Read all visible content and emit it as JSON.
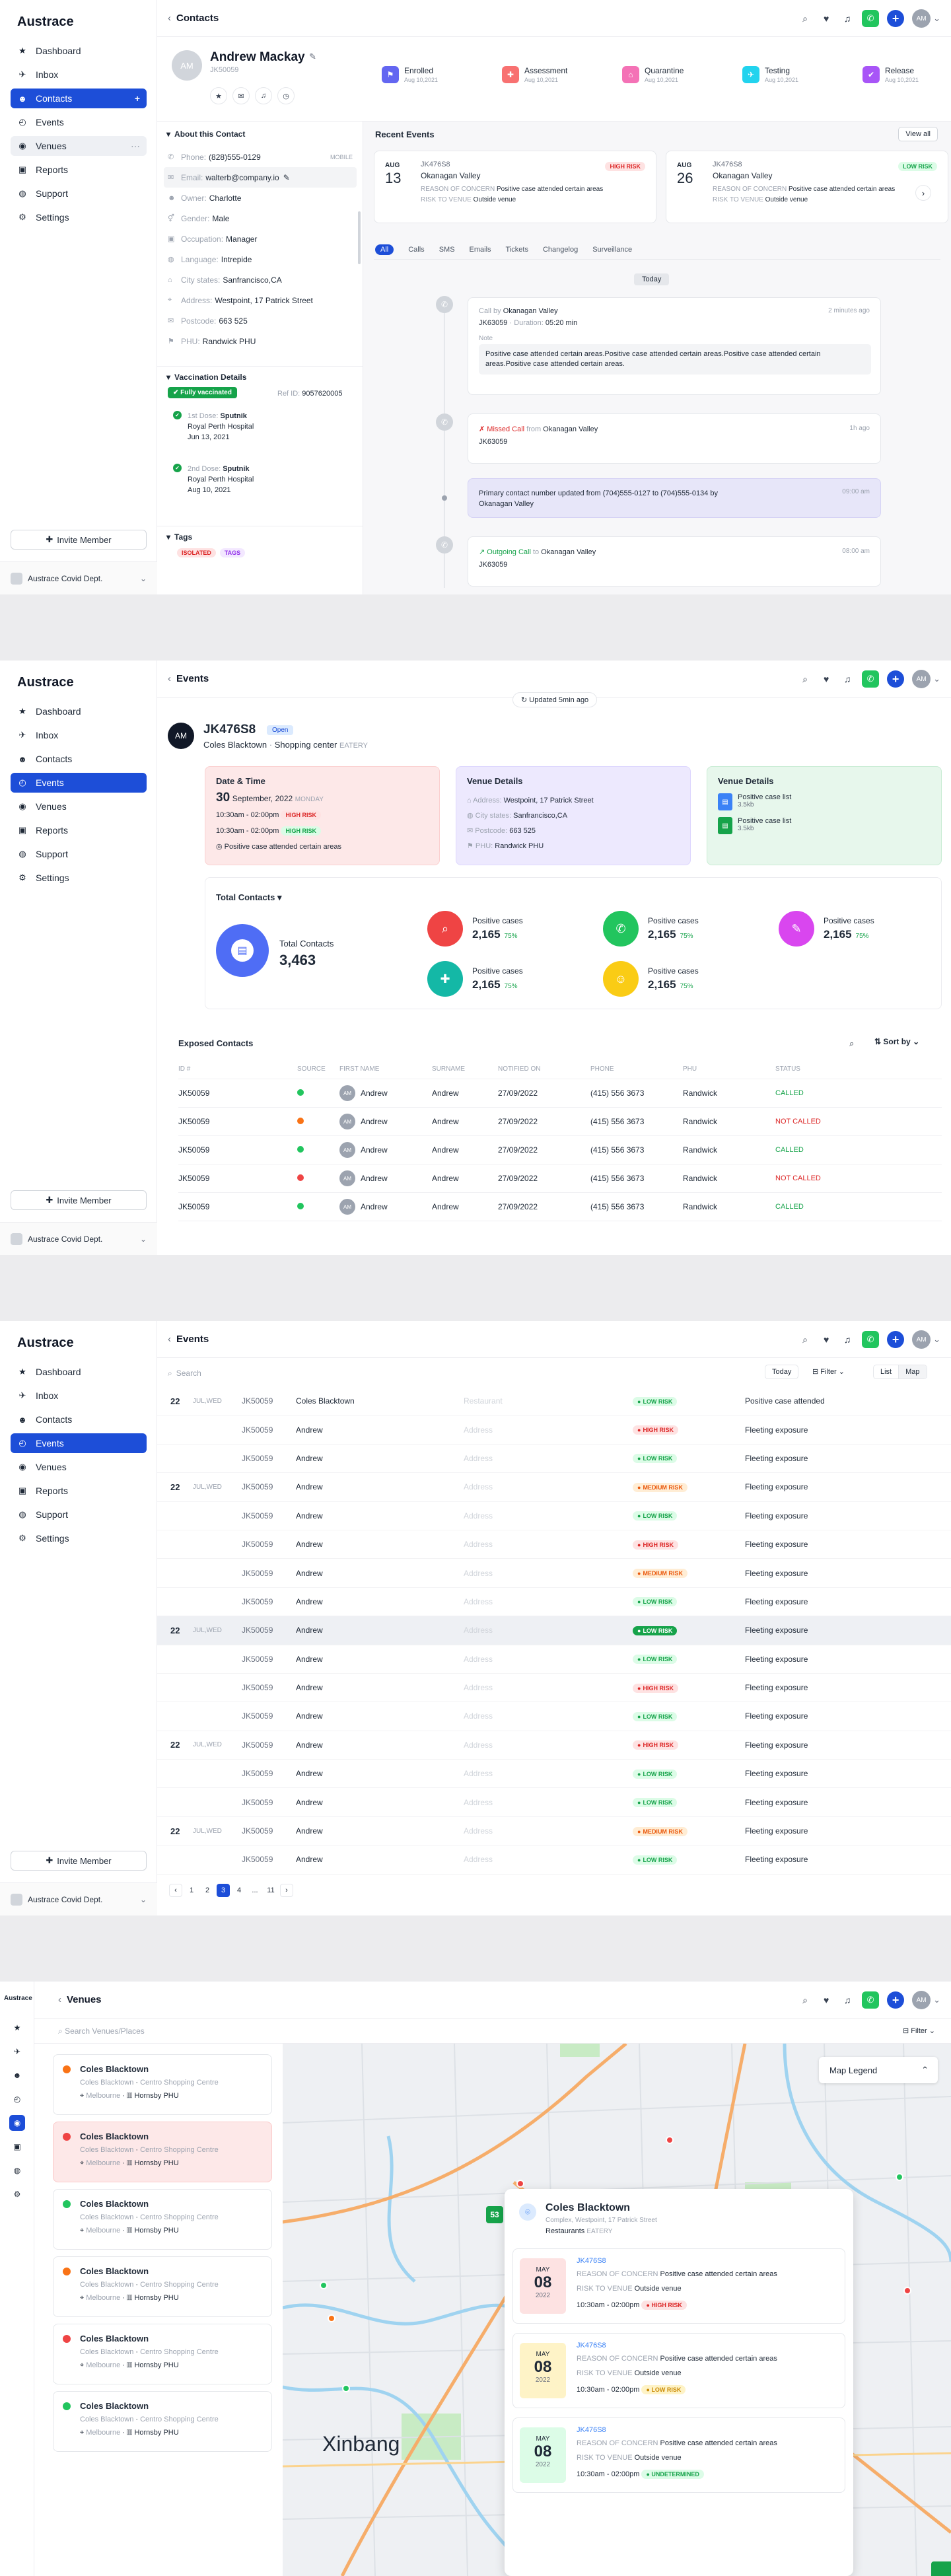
{
  "app": {
    "name": "Austrace",
    "invite": "Invite Member",
    "org": "Austrace Covid Dept.",
    "initials": "AM"
  },
  "nav": [
    {
      "label": "Dashboard",
      "icon": "★"
    },
    {
      "label": "Inbox",
      "icon": "✈"
    },
    {
      "label": "Contacts",
      "icon": "☻"
    },
    {
      "label": "Events",
      "icon": "◴"
    },
    {
      "label": "Venues",
      "icon": "◉"
    },
    {
      "label": "Reports",
      "icon": "▣"
    },
    {
      "label": "Support",
      "icon": "◍"
    },
    {
      "label": "Settings",
      "icon": "⚙"
    }
  ],
  "contacts": {
    "crumb": "Contacts",
    "name": "Andrew Mackay",
    "id": "JK50059",
    "statuses": [
      {
        "label": "Enrolled",
        "date": "Aug 10,2021",
        "color": "#6366f1",
        "icon": "⚑"
      },
      {
        "label": "Assessment",
        "date": "Aug 10,2021",
        "color": "#f87171",
        "icon": "✚"
      },
      {
        "label": "Quarantine",
        "date": "Aug 10,2021",
        "color": "#f472b6",
        "icon": "⌂"
      },
      {
        "label": "Testing",
        "date": "Aug 10,2021",
        "color": "#22d3ee",
        "icon": "✈"
      },
      {
        "label": "Release",
        "date": "Aug 10,2021",
        "color": "#a855f7",
        "icon": "✔"
      }
    ],
    "about_title": "About this Contact",
    "fields": [
      {
        "k": "Phone:",
        "v": "(828)555-0129",
        "tag": "MOBILE"
      },
      {
        "k": "Email:",
        "v": "walterb@company.io"
      },
      {
        "k": "Owner:",
        "v": "Charlotte"
      },
      {
        "k": "Gender:",
        "v": "Male"
      },
      {
        "k": "Occupation:",
        "v": "Manager"
      },
      {
        "k": "Language:",
        "v": "Intrepide"
      },
      {
        "k": "City states:",
        "v": "Sanfrancisco,CA"
      },
      {
        "k": "Address:",
        "v": "Westpoint, 17 Patrick Street"
      },
      {
        "k": "Postcode:",
        "v": "663 525"
      },
      {
        "k": "PHU:",
        "v": "Randwick PHU"
      }
    ],
    "vacc_title": "Vaccination Details",
    "vacc_badge": "Fully vaccinated",
    "ref_label": "Ref ID:",
    "ref": "9057620005",
    "doses": [
      {
        "n": "1st Dose:",
        "vax": "Sputnik",
        "place": "Royal Perth Hospital",
        "date": "Jun 13, 2021"
      },
      {
        "n": "2nd Dose:",
        "vax": "Sputnik",
        "place": "Royal Perth Hospital",
        "date": "Aug 10, 2021"
      }
    ],
    "tags_title": "Tags",
    "tags": [
      "ISOLATED",
      "TAGS"
    ],
    "recent_title": "Recent Events",
    "view_all": "View all",
    "recent": [
      {
        "mon": "AUG",
        "day": "13",
        "code": "JK476S8",
        "venue": "Okanagan Valley",
        "risk": "HIGH RISK",
        "reason_k": "REASON OF CONCERN",
        "reason": "Positive case attended certain areas",
        "rtv_k": "RISK TO VENUE",
        "rtv": "Outside venue"
      },
      {
        "mon": "AUG",
        "day": "26",
        "code": "JK476S8",
        "venue": "Okanagan Valley",
        "risk": "LOW RISK",
        "reason_k": "REASON OF CONCERN",
        "reason": "Positive case attended certain areas",
        "rtv_k": "RISK TO VENUE",
        "rtv": "Outside venue"
      }
    ],
    "filters": [
      "All",
      "Calls",
      "SMS",
      "Emails",
      "Tickets",
      "Changelog",
      "Surveillance"
    ],
    "today": "Today",
    "tl": {
      "call_by": "Call by",
      "venue": "Okanagan Valley",
      "time1": "2 minutes ago",
      "code": "JK63059",
      "dur": "Duration:",
      "dur_v": "05:20 min",
      "note_k": "Note",
      "note": "Positive case attended certain areas.Positive case attended certain areas.Positive case attended certain areas.Positive case attended certain areas.",
      "missed": "Missed Call",
      "from": "from",
      "time2": "1h ago",
      "upd": "Primary contact number updated from (704)555-0127 to (704)555-0134 by",
      "time3": "09:00 am",
      "outgoing": "Outgoing Call",
      "to": "to",
      "time4": "08:00 am"
    }
  },
  "event": {
    "crumb": "Events",
    "updated": "Updated 5min ago",
    "code": "JK476S8",
    "open": "Open",
    "venue": "Coles Blacktown",
    "type": "Shopping center",
    "type_tag": "EATERY",
    "dt_title": "Date & Time",
    "dt_day": "30",
    "dt_month": "September, 2022",
    "dt_dow": "MONDAY",
    "slots": [
      {
        "t": "10:30am - 02:00pm",
        "r": "HIGH RISK"
      },
      {
        "t": "10:30am - 02:00pm",
        "r": "HIGH RISK"
      }
    ],
    "dt_note": "Positive case attended certain areas",
    "vd_title": "Venue Details",
    "vd": [
      {
        "k": "Address:",
        "v": "Westpoint, 17 Patrick Street"
      },
      {
        "k": "City states:",
        "v": "Sanfrancisco,CA"
      },
      {
        "k": "Postcode:",
        "v": "663 525"
      },
      {
        "k": "PHU:",
        "v": "Randwick PHU"
      }
    ],
    "files_title": "Venue Details",
    "files": [
      {
        "n": "Positive case list",
        "s": "3.5kb",
        "c": "#3b82f6"
      },
      {
        "n": "Positive case list",
        "s": "3.5kb",
        "c": "#16a34a"
      }
    ],
    "tc_title": "Total Contacts",
    "tc_label": "Total Contacts",
    "tc_val": "3,463",
    "stats": [
      {
        "l": "Positive cases",
        "v": "2,165",
        "p": "75%",
        "c": "#ef4444",
        "i": "⌕"
      },
      {
        "l": "Positive cases",
        "v": "2,165",
        "p": "75%",
        "c": "#22c55e",
        "i": "✆"
      },
      {
        "l": "Positive cases",
        "v": "2,165",
        "p": "75%",
        "c": "#d946ef",
        "i": "✎"
      },
      {
        "l": "Positive cases",
        "v": "2,165",
        "p": "75%",
        "c": "#14b8a6",
        "i": "✚"
      },
      {
        "l": "Positive cases",
        "v": "2,165",
        "p": "75%",
        "c": "#facc15",
        "i": "☺"
      }
    ],
    "ex_title": "Exposed Contacts",
    "sort": "Sort by",
    "cols": [
      "ID #",
      "SOURCE",
      "FIRST NAME",
      "SURNAME",
      "NOTIFIED ON",
      "PHONE",
      "PHU",
      "STATUS"
    ],
    "rows": [
      {
        "id": "JK50059",
        "src": "#22c55e",
        "fn": "Andrew",
        "sn": "Andrew",
        "d": "27/09/2022",
        "ph": "(415) 556 3673",
        "phu": "Randwick",
        "st": "CALLED"
      },
      {
        "id": "JK50059",
        "src": "#f97316",
        "fn": "Andrew",
        "sn": "Andrew",
        "d": "27/09/2022",
        "ph": "(415) 556 3673",
        "phu": "Randwick",
        "st": "NOT CALLED"
      },
      {
        "id": "JK50059",
        "src": "#22c55e",
        "fn": "Andrew",
        "sn": "Andrew",
        "d": "27/09/2022",
        "ph": "(415) 556 3673",
        "phu": "Randwick",
        "st": "CALLED"
      },
      {
        "id": "JK50059",
        "src": "#ef4444",
        "fn": "Andrew",
        "sn": "Andrew",
        "d": "27/09/2022",
        "ph": "(415) 556 3673",
        "phu": "Randwick",
        "st": "NOT CALLED"
      },
      {
        "id": "JK50059",
        "src": "#22c55e",
        "fn": "Andrew",
        "sn": "Andrew",
        "d": "27/09/2022",
        "ph": "(415) 556 3673",
        "phu": "Randwick",
        "st": "CALLED"
      }
    ]
  },
  "elist": {
    "crumb": "Events",
    "search": "Search",
    "today": "Today",
    "filter": "Filter",
    "list": "List",
    "map": "Map",
    "rows": [
      {
        "d": "22",
        "dw": "JUL,WED",
        "id": "JK50059",
        "n": "Coles Blacktown",
        "a": "Restaurant",
        "r": "LOW RISK",
        "c": "Positive case attended"
      },
      {
        "d": "",
        "dw": "",
        "id": "JK50059",
        "n": "Andrew",
        "a": "Address",
        "r": "HIGH RISK",
        "c": "Fleeting exposure"
      },
      {
        "d": "",
        "dw": "",
        "id": "JK50059",
        "n": "Andrew",
        "a": "Address",
        "r": "LOW RISK",
        "c": "Fleeting exposure"
      },
      {
        "d": "22",
        "dw": "JUL,WED",
        "id": "JK50059",
        "n": "Andrew",
        "a": "Address",
        "r": "MEDIUM RISK",
        "c": "Fleeting exposure"
      },
      {
        "d": "",
        "dw": "",
        "id": "JK50059",
        "n": "Andrew",
        "a": "Address",
        "r": "LOW RISK",
        "c": "Fleeting exposure"
      },
      {
        "d": "",
        "dw": "",
        "id": "JK50059",
        "n": "Andrew",
        "a": "Address",
        "r": "HIGH RISK",
        "c": "Fleeting exposure"
      },
      {
        "d": "",
        "dw": "",
        "id": "JK50059",
        "n": "Andrew",
        "a": "Address",
        "r": "MEDIUM RISK",
        "c": "Fleeting exposure"
      },
      {
        "d": "",
        "dw": "",
        "id": "JK50059",
        "n": "Andrew",
        "a": "Address",
        "r": "LOW RISK",
        "c": "Fleeting exposure"
      },
      {
        "d": "22",
        "dw": "JUL,WED",
        "id": "JK50059",
        "n": "Andrew",
        "a": "Address",
        "r": "LOW RISK",
        "c": "Fleeting exposure",
        "hl": true
      },
      {
        "d": "",
        "dw": "",
        "id": "JK50059",
        "n": "Andrew",
        "a": "Address",
        "r": "LOW RISK",
        "c": "Fleeting exposure"
      },
      {
        "d": "",
        "dw": "",
        "id": "JK50059",
        "n": "Andrew",
        "a": "Address",
        "r": "HIGH RISK",
        "c": "Fleeting exposure"
      },
      {
        "d": "",
        "dw": "",
        "id": "JK50059",
        "n": "Andrew",
        "a": "Address",
        "r": "LOW RISK",
        "c": "Fleeting exposure"
      },
      {
        "d": "22",
        "dw": "JUL,WED",
        "id": "JK50059",
        "n": "Andrew",
        "a": "Address",
        "r": "HIGH RISK",
        "c": "Fleeting exposure"
      },
      {
        "d": "",
        "dw": "",
        "id": "JK50059",
        "n": "Andrew",
        "a": "Address",
        "r": "LOW RISK",
        "c": "Fleeting exposure"
      },
      {
        "d": "",
        "dw": "",
        "id": "JK50059",
        "n": "Andrew",
        "a": "Address",
        "r": "LOW RISK",
        "c": "Fleeting exposure"
      },
      {
        "d": "22",
        "dw": "JUL,WED",
        "id": "JK50059",
        "n": "Andrew",
        "a": "Address",
        "r": "MEDIUM RISK",
        "c": "Fleeting exposure"
      },
      {
        "d": "",
        "dw": "",
        "id": "JK50059",
        "n": "Andrew",
        "a": "Address",
        "r": "LOW RISK",
        "c": "Fleeting exposure"
      }
    ],
    "pages": [
      "‹",
      "1",
      "2",
      "3",
      "4",
      "...",
      "11",
      "›"
    ],
    "page_on": "3"
  },
  "venues": {
    "crumb": "Venues",
    "search": "Search Venues/Places",
    "filter": "Filter",
    "legend": "Map Legend",
    "city": "Xinbang",
    "marker": "53",
    "list": [
      {
        "n": "Coles Blacktown",
        "t": "Coles Blacktown",
        "s": "Centro Shopping Centre",
        "c": "Melbourne",
        "p": "Hornsby PHU",
        "dot": "#f97316"
      },
      {
        "n": "Coles Blacktown",
        "t": "Coles Blacktown",
        "s": "Centro Shopping Centre",
        "c": "Melbourne",
        "p": "Hornsby PHU",
        "dot": "#ef4444",
        "sel": true
      },
      {
        "n": "Coles Blacktown",
        "t": "Coles Blacktown",
        "s": "Centro Shopping Centre",
        "c": "Melbourne",
        "p": "Hornsby PHU",
        "dot": "#22c55e"
      },
      {
        "n": "Coles Blacktown",
        "t": "Coles Blacktown",
        "s": "Centro Shopping Centre",
        "c": "Melbourne",
        "p": "Hornsby PHU",
        "dot": "#f97316"
      },
      {
        "n": "Coles Blacktown",
        "t": "Coles Blacktown",
        "s": "Centro Shopping Centre",
        "c": "Melbourne",
        "p": "Hornsby PHU",
        "dot": "#ef4444"
      },
      {
        "n": "Coles Blacktown",
        "t": "Coles Blacktown",
        "s": "Centro Shopping Centre",
        "c": "Melbourne",
        "p": "Hornsby PHU",
        "dot": "#22c55e"
      }
    ],
    "pop": {
      "name": "Coles Blacktown",
      "addr": "Complex, Westpoint, 17 Patrick Street",
      "type": "Restaurants",
      "type_tag": "EATERY",
      "events": [
        {
          "mon": "MAY",
          "day": "08",
          "yr": "2022",
          "code": "JK476S8",
          "rk": "REASON OF CONCERN",
          "r": "Positive case attended certain areas",
          "vk": "RISK TO VENUE",
          "v": "Outside venue",
          "t": "10:30am - 02:00pm",
          "risk": "HIGH RISK",
          "bg": "#fde2e2",
          "fg": "#dc2626"
        },
        {
          "mon": "MAY",
          "day": "08",
          "yr": "2022",
          "code": "JK476S8",
          "rk": "REASON OF CONCERN",
          "r": "Positive case attended certain areas",
          "vk": "RISK TO VENUE",
          "v": "Outside venue",
          "t": "10:30am - 02:00pm",
          "risk": "LOW RISK",
          "bg": "#fef3c7",
          "fg": "#ca8a04"
        },
        {
          "mon": "MAY",
          "day": "08",
          "yr": "2022",
          "code": "JK476S8",
          "rk": "REASON OF CONCERN",
          "r": "Positive case attended certain areas",
          "vk": "RISK TO VENUE",
          "v": "Outside venue",
          "t": "10:30am - 02:00pm",
          "risk": "UNDETERMINED",
          "bg": "#dcfce7",
          "fg": "#16a34a"
        }
      ]
    }
  }
}
